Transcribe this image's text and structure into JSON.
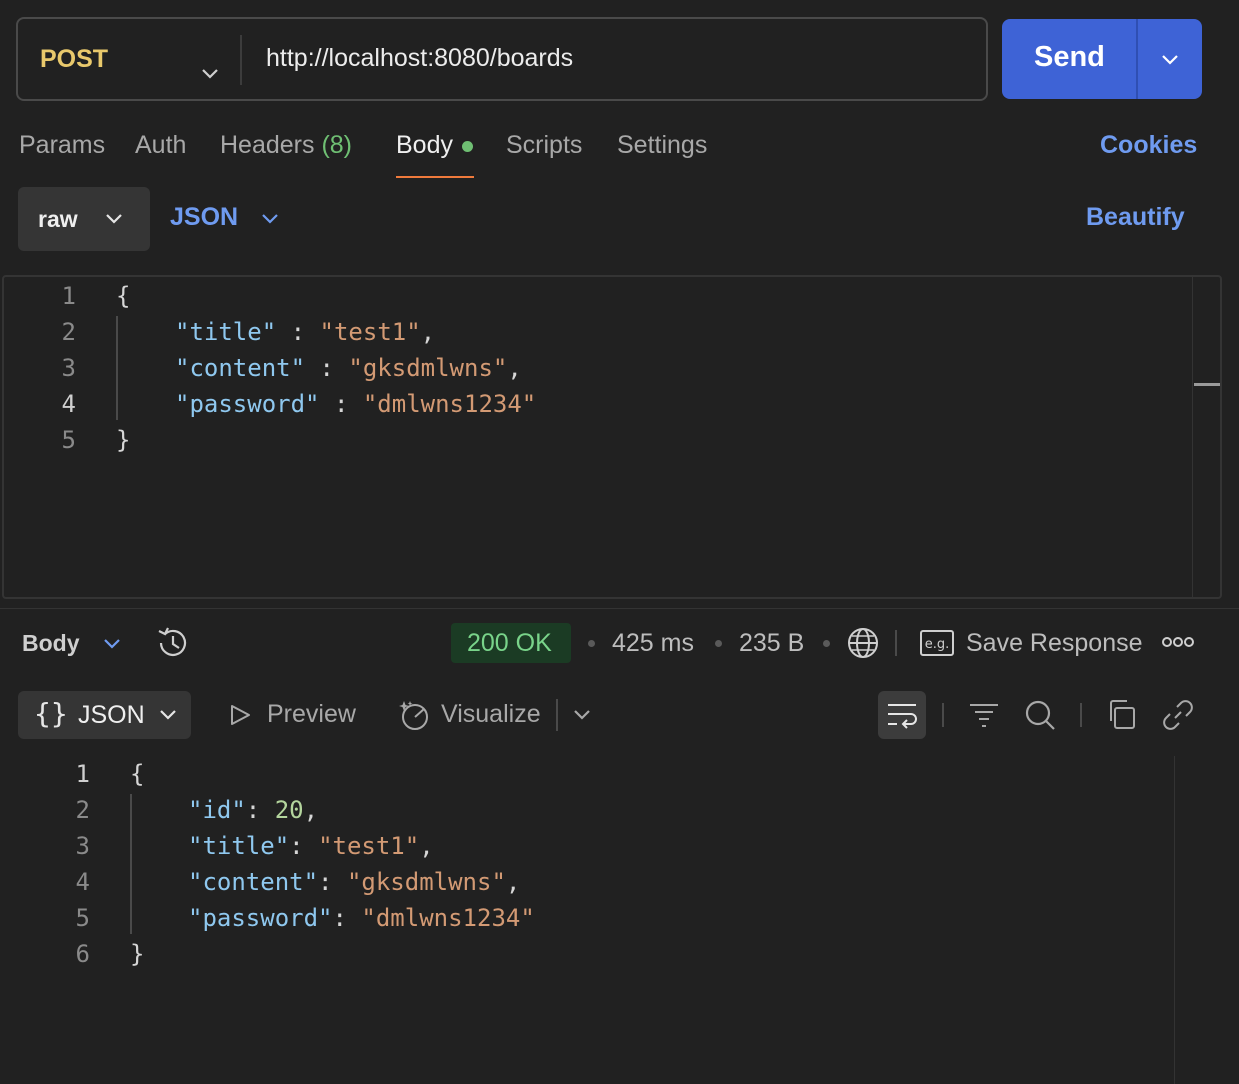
{
  "request": {
    "method": "POST",
    "url": "http://localhost:8080/boards",
    "send_label": "Send"
  },
  "tabs": {
    "params": "Params",
    "auth": "Auth",
    "headers": "Headers",
    "headers_count": "(8)",
    "body": "Body",
    "scripts": "Scripts",
    "settings": "Settings",
    "cookies": "Cookies"
  },
  "body_options": {
    "mode": "raw",
    "language": "JSON",
    "beautify": "Beautify"
  },
  "request_body": {
    "line_numbers": [
      "1",
      "2",
      "3",
      "4",
      "5"
    ],
    "lines": [
      [
        {
          "t": "p",
          "v": "{"
        }
      ],
      [
        {
          "t": "k",
          "v": "\"title\""
        },
        {
          "t": "p",
          "v": " : "
        },
        {
          "t": "s",
          "v": "\"test1\""
        },
        {
          "t": "p",
          "v": ","
        }
      ],
      [
        {
          "t": "k",
          "v": "\"content\""
        },
        {
          "t": "p",
          "v": " : "
        },
        {
          "t": "s",
          "v": "\"gksdmlwns\""
        },
        {
          "t": "p",
          "v": ","
        }
      ],
      [
        {
          "t": "k",
          "v": "\"password\""
        },
        {
          "t": "p",
          "v": " : "
        },
        {
          "t": "s",
          "v": "\"dmlwns1234\""
        }
      ],
      [
        {
          "t": "p",
          "v": "}"
        }
      ]
    ]
  },
  "response": {
    "section_label": "Body",
    "status": "200 OK",
    "time": "425 ms",
    "size": "235 B",
    "save_label": "Save Response",
    "view_mode": "JSON",
    "preview_label": "Preview",
    "visualize_label": "Visualize",
    "line_numbers": [
      "1",
      "2",
      "3",
      "4",
      "5",
      "6"
    ],
    "lines": [
      [
        {
          "t": "p",
          "v": "{"
        }
      ],
      [
        {
          "t": "k",
          "v": "\"id\""
        },
        {
          "t": "p",
          "v": ": "
        },
        {
          "t": "n",
          "v": "20"
        },
        {
          "t": "p",
          "v": ","
        }
      ],
      [
        {
          "t": "k",
          "v": "\"title\""
        },
        {
          "t": "p",
          "v": ": "
        },
        {
          "t": "s",
          "v": "\"test1\""
        },
        {
          "t": "p",
          "v": ","
        }
      ],
      [
        {
          "t": "k",
          "v": "\"content\""
        },
        {
          "t": "p",
          "v": ": "
        },
        {
          "t": "s",
          "v": "\"gksdmlwns\""
        },
        {
          "t": "p",
          "v": ","
        }
      ],
      [
        {
          "t": "k",
          "v": "\"password\""
        },
        {
          "t": "p",
          "v": ": "
        },
        {
          "t": "s",
          "v": "\"dmlwns1234\""
        }
      ],
      [
        {
          "t": "p",
          "v": "}"
        }
      ]
    ]
  },
  "colors": {
    "method": "#e9c96c",
    "send": "#3e63d6",
    "link": "#6f9bf0",
    "status_ok": "#79d48a",
    "active_tab_underline": "#ef7a3c",
    "json_key": "#8fc8ef",
    "json_string": "#d39a74",
    "json_number": "#b4d59d"
  },
  "icons": {
    "method_dropdown": "chevron-down-icon",
    "send_dropdown": "chevron-down-icon",
    "history": "history-icon",
    "network": "globe-icon",
    "example": "eg-icon",
    "more": "more-icon",
    "preview": "play-icon",
    "visualize": "visualize-icon",
    "wrap": "wrap-lines-icon",
    "filter": "filter-icon",
    "search": "search-icon",
    "copy": "copy-icon",
    "link": "link-icon"
  }
}
